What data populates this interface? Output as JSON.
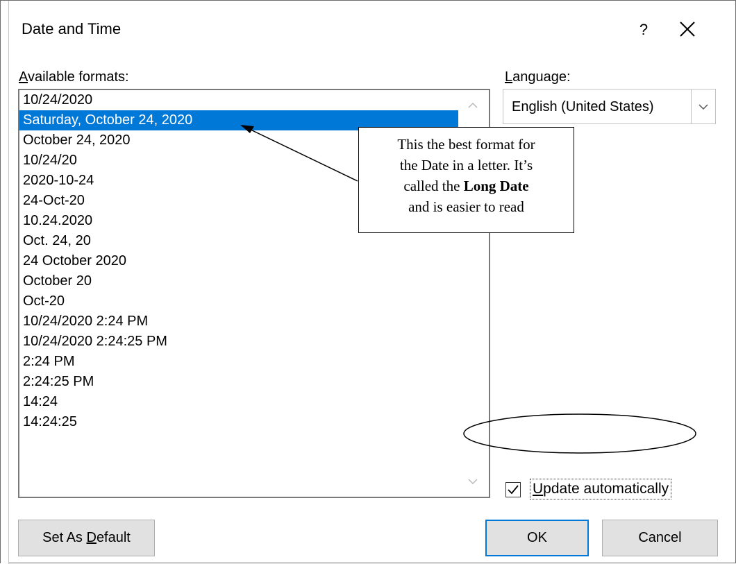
{
  "dialog": {
    "title": "Date and Time",
    "help_label": "?"
  },
  "formats": {
    "label_accel": "A",
    "label_rest": "vailable formats:",
    "items": [
      "10/24/2020",
      "Saturday, October 24, 2020",
      "October 24, 2020",
      "10/24/20",
      "2020-10-24",
      "24-Oct-20",
      "10.24.2020",
      "Oct. 24, 20",
      "24 October 2020",
      "October 20",
      "Oct-20",
      "10/24/2020 2:24 PM",
      "10/24/2020 2:24:25 PM",
      "2:24 PM",
      "2:24:25 PM",
      "14:24",
      "14:24:25"
    ],
    "selected_index": 1
  },
  "language": {
    "label_accel": "L",
    "label_rest": "anguage:",
    "value": "English (United States)"
  },
  "callout": {
    "line1": "This the best format for",
    "line2": "the Date in a letter. It’s",
    "line3_pre": "called the ",
    "line3_bold": "Long Date",
    "line4": "and is easier to read"
  },
  "update": {
    "label_accel": "U",
    "label_rest": "pdate automatically",
    "checked": true
  },
  "buttons": {
    "set_default_pre": "Set As ",
    "set_default_accel": "D",
    "set_default_post": "efault",
    "ok": "OK",
    "cancel": "Cancel"
  },
  "colors": {
    "selection": "#0078d7",
    "ok_border": "#0078d7"
  }
}
